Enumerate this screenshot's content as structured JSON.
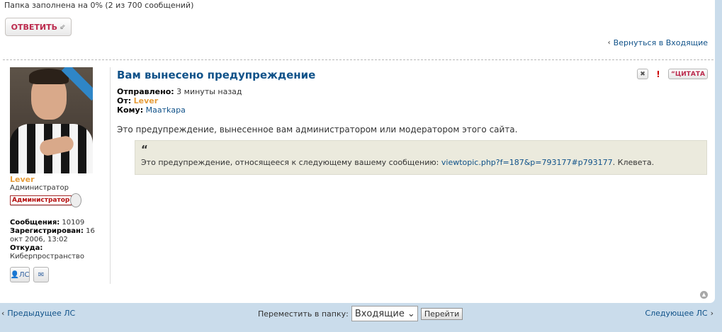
{
  "folder_status": "Папка заполнена на 0% (2 из 700 сообщений)",
  "reply_button": "ОТВЕТИТЬ",
  "back_link": "Вернуться в Входящие",
  "post": {
    "title": "Вам вынесено предупреждение",
    "sent_label": "Отправлено:",
    "sent_value": "3 минуты назад",
    "from_label": "От:",
    "from_value": "Lever",
    "to_label": "Кому:",
    "to_value": "Маатkара",
    "actions": {
      "quote": "ЦИТАТА"
    },
    "content": "Это предупреждение, вынесенное вам администратором или модератором этого сайта.",
    "quote_mark": "“",
    "quote_text": "Это предупреждение, относящееся к следующему вашему сообщению: ",
    "quote_link": "viewtopic.php?f=187&p=793177#p793177",
    "quote_tail": ". Клевета."
  },
  "profile": {
    "name": "Lever",
    "rank": "Администратор",
    "rank_badge": "Администратор",
    "posts_label": "Сообщения:",
    "posts_value": "10109",
    "registered_label": "Зарегистрирован:",
    "registered_value": "16 окт 2006, 13:02",
    "from_label": "Откуда:",
    "from_value": "Киберпространство",
    "pm_label": "ЛС"
  },
  "footer": {
    "prev": "Предыдущее ЛС",
    "next": "Следующее ЛС",
    "move_label": "Переместить в папку:",
    "folder_selected": "Входящие",
    "go": "Перейти"
  },
  "colors": {
    "link": "#105289",
    "author": "#e59c3a",
    "accent": "#bc2a4d",
    "page_bg": "#cadceb"
  }
}
